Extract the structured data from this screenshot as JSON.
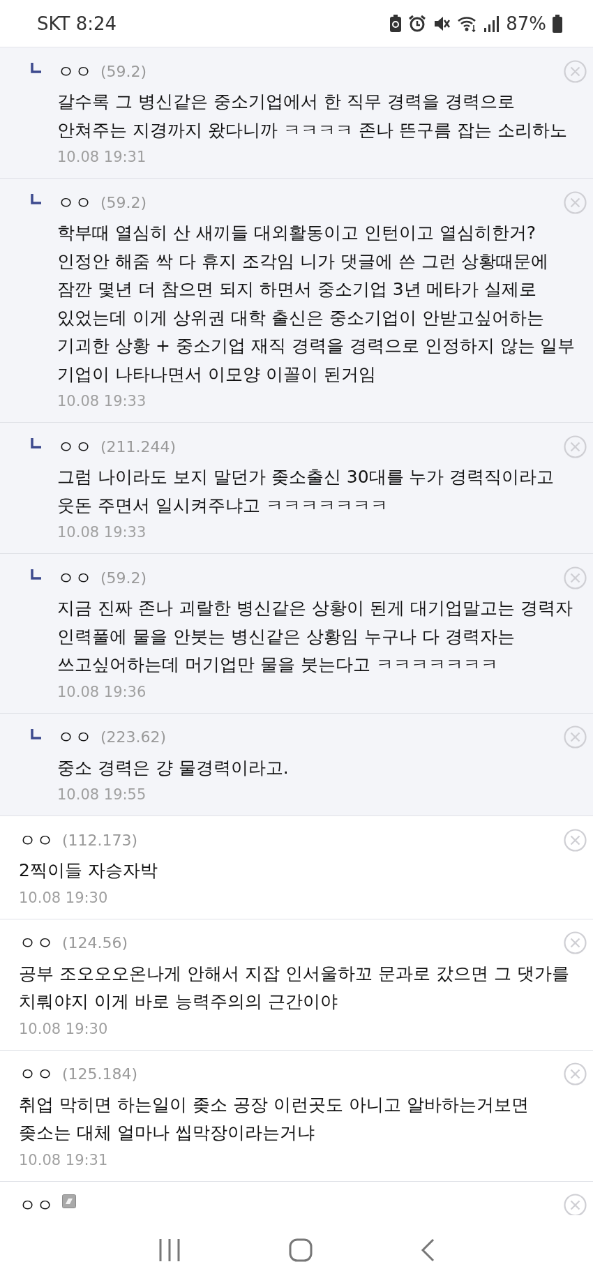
{
  "status_bar": {
    "carrier_time": "SKT 8:24",
    "battery": "87%"
  },
  "comments": [
    {
      "kind": "reply",
      "name": "ㅇㅇ",
      "ip": "(59.2)",
      "text": "갈수록 그 병신같은 중소기업에서 한 직무 경력을 경력으로 안쳐주는 지경까지 왔다니까 ㅋㅋㅋㅋ 존나 뜬구름 잡는 소리하노",
      "date": "10.08 19:31",
      "member_icon": false
    },
    {
      "kind": "reply",
      "name": "ㅇㅇ",
      "ip": "(59.2)",
      "text": "학부때 열심히 산 새끼들 대외활동이고 인턴이고 열심히한거? 인정안 해줌 싹 다 휴지 조각임 니가 댓글에 쓴 그런 상황때문에 잠깐 몇년 더 참으면 되지 하면서 중소기업 3년 메타가 실제로 있었는데 이게 상위권 대학 출신은 중소기업이 안받고싶어하는 기괴한 상황 + 중소기업 재직 경력을 경력으로 인정하지 않는 일부 기업이 나타나면서 이모양 이꼴이 된거임",
      "date": "10.08 19:33",
      "member_icon": false
    },
    {
      "kind": "reply",
      "name": "ㅇㅇ",
      "ip": "(211.244)",
      "text": "그럼 나이라도 보지 말던가 좆소출신 30대를 누가 경력직이라고 웃돈 주면서 일시켜주냐고 ㅋㅋㅋㅋㅋㅋㅋ",
      "date": "10.08 19:33",
      "member_icon": false
    },
    {
      "kind": "reply",
      "name": "ㅇㅇ",
      "ip": "(59.2)",
      "text": "지금 진짜 존나 괴랄한 병신같은 상황이 된게 대기업말고는 경력자 인력풀에 물을 안붓는 병신같은 상황임 누구나 다 경력자는 쓰고싶어하는데 머기업만 물을 붓는다고 ㅋㅋㅋㅋㅋㅋㅋ",
      "date": "10.08 19:36",
      "member_icon": false
    },
    {
      "kind": "reply",
      "name": "ㅇㅇ",
      "ip": "(223.62)",
      "text": "중소 경력은 걍 물경력이라고.",
      "date": "10.08 19:55",
      "member_icon": false
    },
    {
      "kind": "comment",
      "name": "ㅇㅇ",
      "ip": "(112.173)",
      "text": "2찍이들 자승자박",
      "date": "10.08 19:30",
      "member_icon": false
    },
    {
      "kind": "comment",
      "name": "ㅇㅇ",
      "ip": "(124.56)",
      "text": "공부 조오오오온나게 안해서 지잡 인서울하꼬 문과로 갔으면 그 댓가를 치뤄야지 이게 바로 능력주의의 근간이야",
      "date": "10.08 19:30",
      "member_icon": false
    },
    {
      "kind": "comment",
      "name": "ㅇㅇ",
      "ip": "(125.184)",
      "text": "취업 막히면 하는일이 좆소 공장 이런곳도 아니고 알바하는거보면 좆소는 대체 얼마나 씹막장이라는거냐",
      "date": "10.08 19:31",
      "member_icon": false
    },
    {
      "kind": "comment",
      "name": "ㅇㅇ",
      "member_icon": true
    }
  ]
}
